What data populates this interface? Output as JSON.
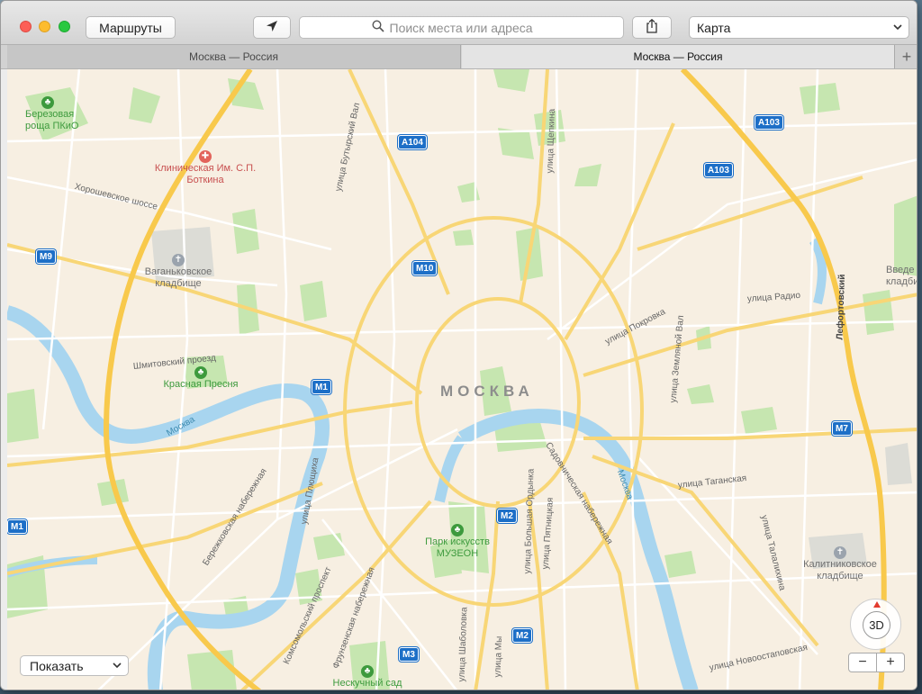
{
  "toolbar": {
    "routes_label": "Маршруты",
    "search_placeholder": "Поиск места или адреса",
    "map_type": "Карта"
  },
  "tabs": [
    {
      "label": "Москва — Россия",
      "active": false
    },
    {
      "label": "Москва — Россия",
      "active": true
    }
  ],
  "map": {
    "city_label": "МОСКВА",
    "pois": [
      {
        "name": "Березовая роща ПКиО",
        "type": "park"
      },
      {
        "name": "Клиническая Им. С.П. Боткина",
        "type": "hospital"
      },
      {
        "name": "Ваганьковское кладбище",
        "type": "cemetery"
      },
      {
        "name": "Красная Пресня",
        "type": "park"
      },
      {
        "name": "Парк искусств МУЗЕОН",
        "type": "park"
      },
      {
        "name": "Калитниковское кладбище",
        "type": "cemetery"
      },
      {
        "name": "Введе кладбище",
        "type": "cemetery"
      },
      {
        "name": "Нескучный сад",
        "type": "park"
      }
    ],
    "streets": [
      "Хорошевское шоссе",
      "улица Бутырский Вал",
      "улица Щепкина",
      "Шмитовский проезд",
      "Бережковская набережная",
      "улица Плющиха",
      "Комсомольский проспект",
      "Фрунзенская набережная",
      "улица Шаболовка",
      "улица Большая Ордынка",
      "улица Пятницкая",
      "Садовническая набережная",
      "улица Покровка",
      "улица Земляной Вал",
      "улица Радио",
      "Лефортовский",
      "улица Таганская",
      "улица Талалихина",
      "улица Новоостаповская",
      "улица Мы"
    ],
    "rivers": [
      "Москва",
      "Москва"
    ],
    "highway_shields": [
      "A104",
      "A103",
      "A103",
      "M9",
      "M10",
      "M1",
      "M1",
      "M7",
      "M2",
      "M2",
      "M3"
    ]
  },
  "controls": {
    "show_label": "Показать",
    "compass_label": "3D",
    "zoom_out": "−",
    "zoom_in": "+"
  },
  "colors": {
    "land": "#f7efe2",
    "park": "#c6e6b0",
    "water": "#a8d5ef",
    "major_road": "#f8c94c",
    "minor_road": "#ffffff",
    "shield": "#1d6fc7"
  }
}
